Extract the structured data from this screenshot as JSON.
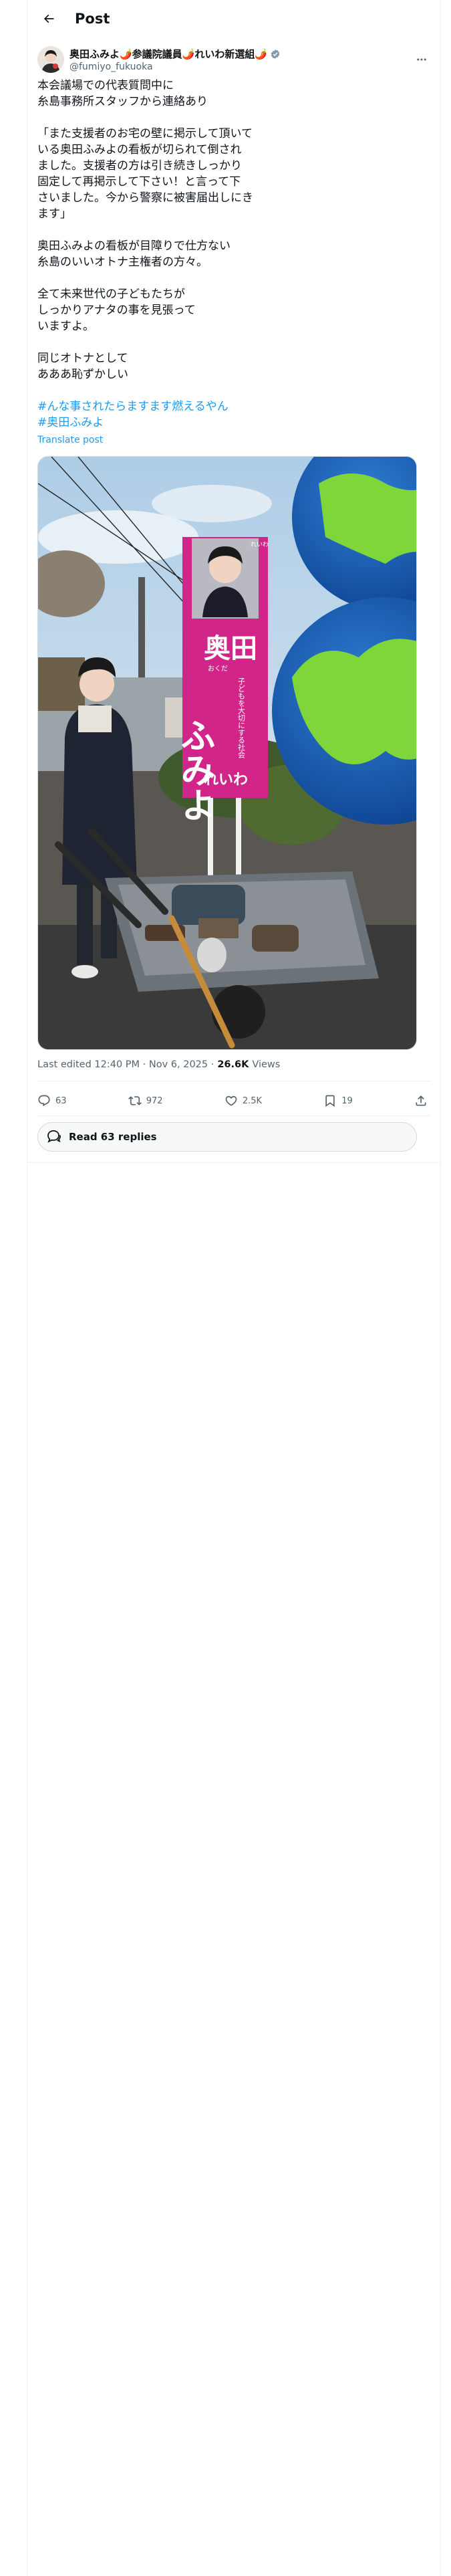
{
  "header": {
    "title": "Post"
  },
  "author": {
    "name": "奥田ふみよ🌶️参議院議員🌶️れいわ新選組🌶️",
    "handle": "@fumiyo_fukuoka"
  },
  "post": {
    "paragraphs": [
      "本会議場での代表質問中に\n糸島事務所スタッフから連絡あり",
      "「また支援者のお宅の壁に掲示して頂いて\nいる奥田ふみよの看板が切られて倒され\nました。支援者の方は引き続きしっかり\n固定して再掲示して下さい！と言って下\nさいました。今から警察に被害届出しにき\nます」",
      "奥田ふみよの看板が目障りで仕方ない\n糸島のいいオトナ主権者の方々。",
      "全て未来世代の子どもたちが\nしっかりアナタの事を見張って\nいますよ。",
      "同じオトナとして\nあああ恥ずかしい"
    ],
    "hashtags": [
      "#んな事されたらますます燃えるやん",
      "#奥田ふみよ"
    ],
    "translate_label": "Translate post"
  },
  "media": {
    "sign_surname": "奥田",
    "sign_surname_reading": "おくだ",
    "sign_given": "ふみよ",
    "sign_party": "れいわ",
    "sign_slogan": "子どもを大切にする社会",
    "sign_tag": "れいわ"
  },
  "meta": {
    "edited": "Last edited 12:40 PM · Nov 6, 2025 · ",
    "views_count": "26.6K",
    "views_label": "Views"
  },
  "actions": {
    "replies": "63",
    "reposts": "972",
    "likes": "2.5K",
    "bookmarks": "19"
  },
  "read_replies": "Read 63 replies",
  "colors": {
    "accent": "#1d9bf0",
    "sign_magenta": "#d1258a",
    "sky": "#bcd6ea"
  }
}
